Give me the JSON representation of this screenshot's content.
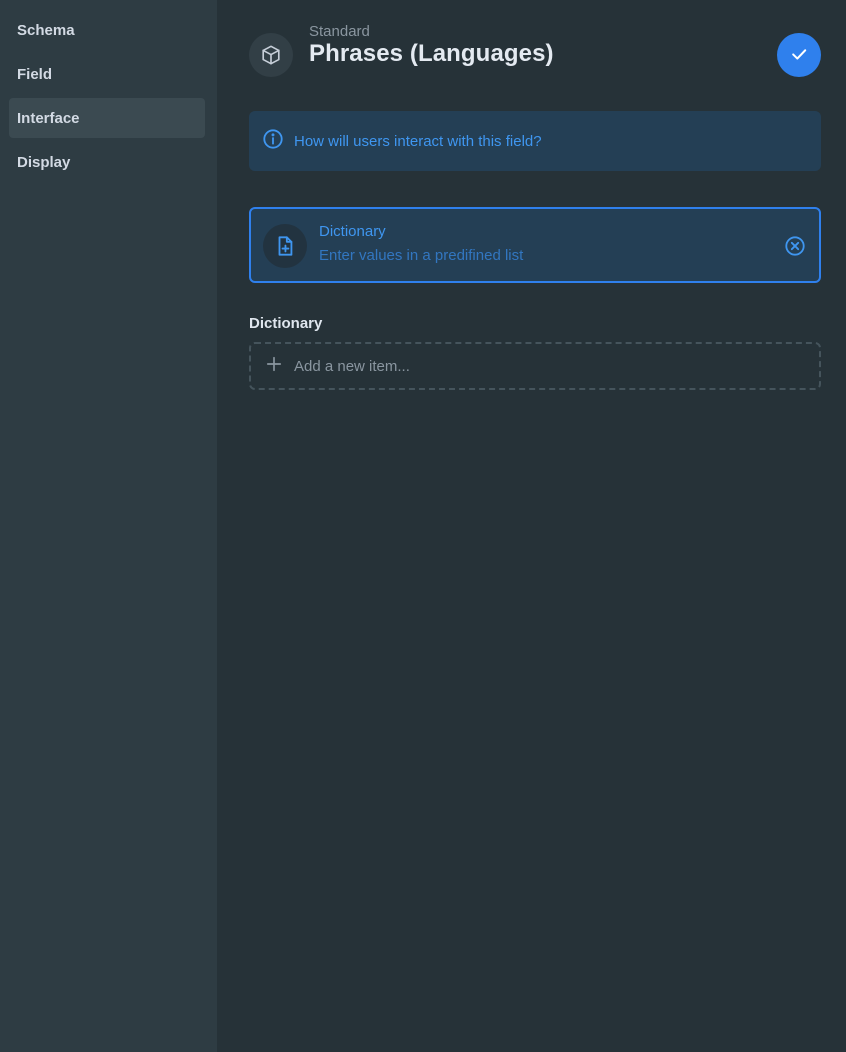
{
  "sidebar": {
    "items": [
      {
        "label": "Schema"
      },
      {
        "label": "Field"
      },
      {
        "label": "Interface",
        "active": true
      },
      {
        "label": "Display"
      }
    ]
  },
  "header": {
    "icon": "cube-icon",
    "subtitle": "Standard",
    "title": "Phrases (Languages)",
    "save_icon": "check-icon"
  },
  "notice": {
    "icon": "info-icon",
    "text": "How will users interact with this field?"
  },
  "selected_interface": {
    "icon": "file-plus-icon",
    "title": "Dictionary",
    "description": "Enter values in a predifined list",
    "clear_icon": "close-circle-icon"
  },
  "dictionary": {
    "label": "Dictionary",
    "add_icon": "plus-icon",
    "add_placeholder": "Add a new item..."
  },
  "colors": {
    "background": "#263238",
    "sidebar": "#2e3c43",
    "accent": "#2f80ed",
    "notice_bg": "#243f55"
  }
}
